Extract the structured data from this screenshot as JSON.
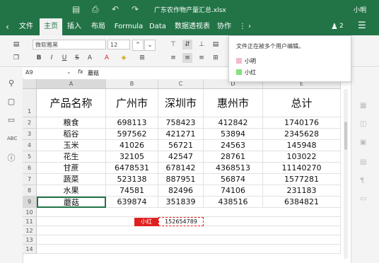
{
  "window": {
    "file_title": "广东农作物产量汇总.xlsx",
    "user_name": "小明"
  },
  "tabs": [
    {
      "label": "文件"
    },
    {
      "label": "主页"
    },
    {
      "label": "插入"
    },
    {
      "label": "布局"
    },
    {
      "label": "Formula"
    },
    {
      "label": "Data"
    },
    {
      "label": "数据透视表"
    },
    {
      "label": "协作"
    }
  ],
  "collab_count": "2",
  "ribbon": {
    "font_name": "微软雅黑",
    "font_size": "12"
  },
  "formula_bar": {
    "cell_ref": "A9",
    "fx": "fx",
    "value": "蘑菇"
  },
  "popup": {
    "message": "文件正在被多个用户编辑。",
    "users": [
      {
        "name": "小明",
        "color": "#f4b8d0"
      },
      {
        "name": "小红",
        "color": "#86e07e"
      }
    ]
  },
  "columns": [
    "A",
    "B",
    "C",
    "D",
    "E"
  ],
  "header_row": [
    "产品名称",
    "广州市",
    "深圳市",
    "惠州市",
    "总计"
  ],
  "row_numbers": [
    "1",
    "2",
    "3",
    "4",
    "5",
    "6",
    "7",
    "8",
    "9",
    "10",
    "11",
    "12",
    "13",
    "14"
  ],
  "rows": [
    [
      "粮食",
      "698113",
      "758423",
      "412842",
      "1740176"
    ],
    [
      "稻谷",
      "597562",
      "421271",
      "53894",
      "2345628"
    ],
    [
      "玉米",
      "41026",
      "56721",
      "24563",
      "145948"
    ],
    [
      "花生",
      "32105",
      "42547",
      "28761",
      "103022"
    ],
    [
      "甘蔗",
      "6478531",
      "678142",
      "4368513",
      "11140270"
    ],
    [
      "蔬菜",
      "523138",
      "887951",
      "56874",
      "1577281"
    ],
    [
      "水果",
      "74581",
      "82496",
      "74106",
      "231183"
    ],
    [
      "蘑菇",
      "639874",
      "351839",
      "438516",
      "6384821"
    ]
  ],
  "collab_cell": {
    "user_label": "小红",
    "value": "152654789"
  },
  "colors": {
    "brand": "#227447",
    "collab_red": "#e02020"
  }
}
